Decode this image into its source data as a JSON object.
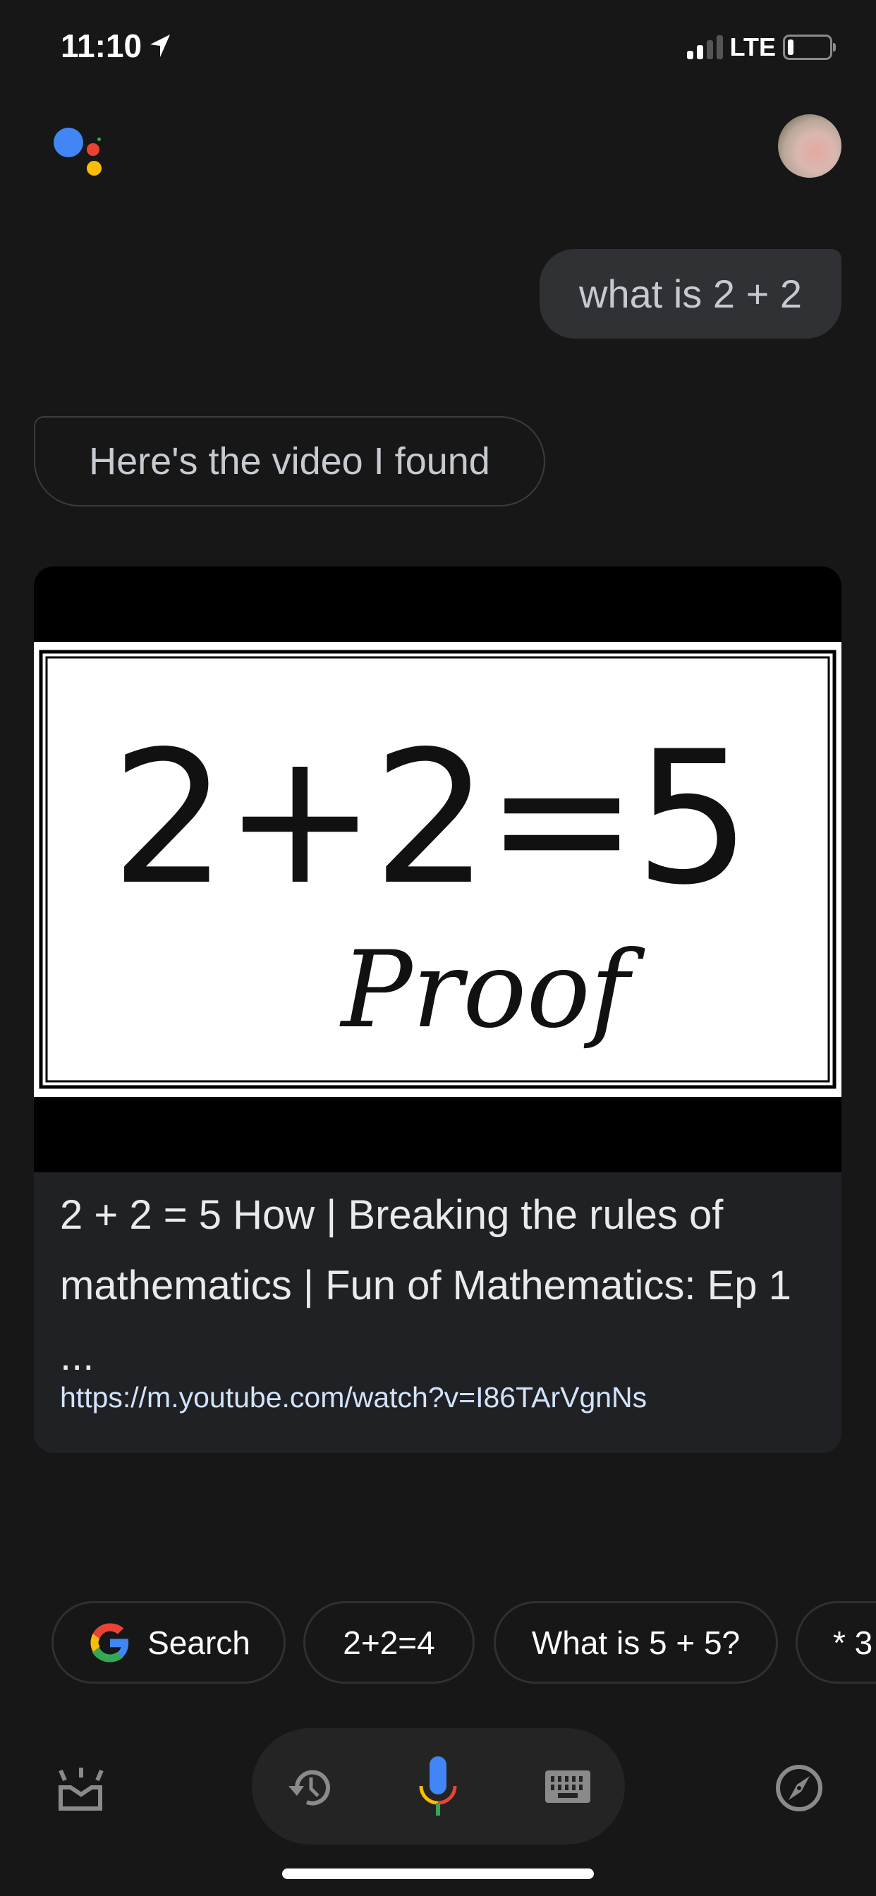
{
  "status_bar": {
    "time": "11:10",
    "network": "LTE",
    "signal_bars_filled": 2,
    "signal_bars_total": 4,
    "battery_level_percent": 10,
    "icons": [
      "location-arrow-icon",
      "signal-icon",
      "battery-icon"
    ]
  },
  "header": {
    "logo": "google-assistant-logo",
    "avatar": "user-avatar"
  },
  "conversation": {
    "user_query": "what is 2 + 2",
    "assistant_reply": "Here's the video I found"
  },
  "video_card": {
    "thumbnail_text": {
      "equation": "2+2=5",
      "caption": "Proof"
    },
    "title": "2 + 2 = 5 How | Breaking the rules of mathematics | Fun of Mathematics: Ep 1 ...",
    "url": "https://m.youtube.com/watch?v=I86TArVgnNs"
  },
  "suggestion_chips": [
    {
      "label": "Search",
      "icon": "google-g-icon"
    },
    {
      "label": "2+2=4"
    },
    {
      "label": "What is 5 + 5?"
    },
    {
      "label": "* 3"
    }
  ],
  "bottom_bar": {
    "icons": [
      "updates-inbox-icon",
      "history-icon",
      "microphone-icon",
      "keyboard-icon",
      "explore-compass-icon"
    ]
  },
  "colors": {
    "background": "#171717",
    "bubble": "#303134",
    "card": "#202124",
    "link": "#d2e3fc",
    "google_blue": "#4285f4",
    "google_red": "#ea4335",
    "google_yellow": "#fbbc05",
    "google_green": "#34a853"
  }
}
